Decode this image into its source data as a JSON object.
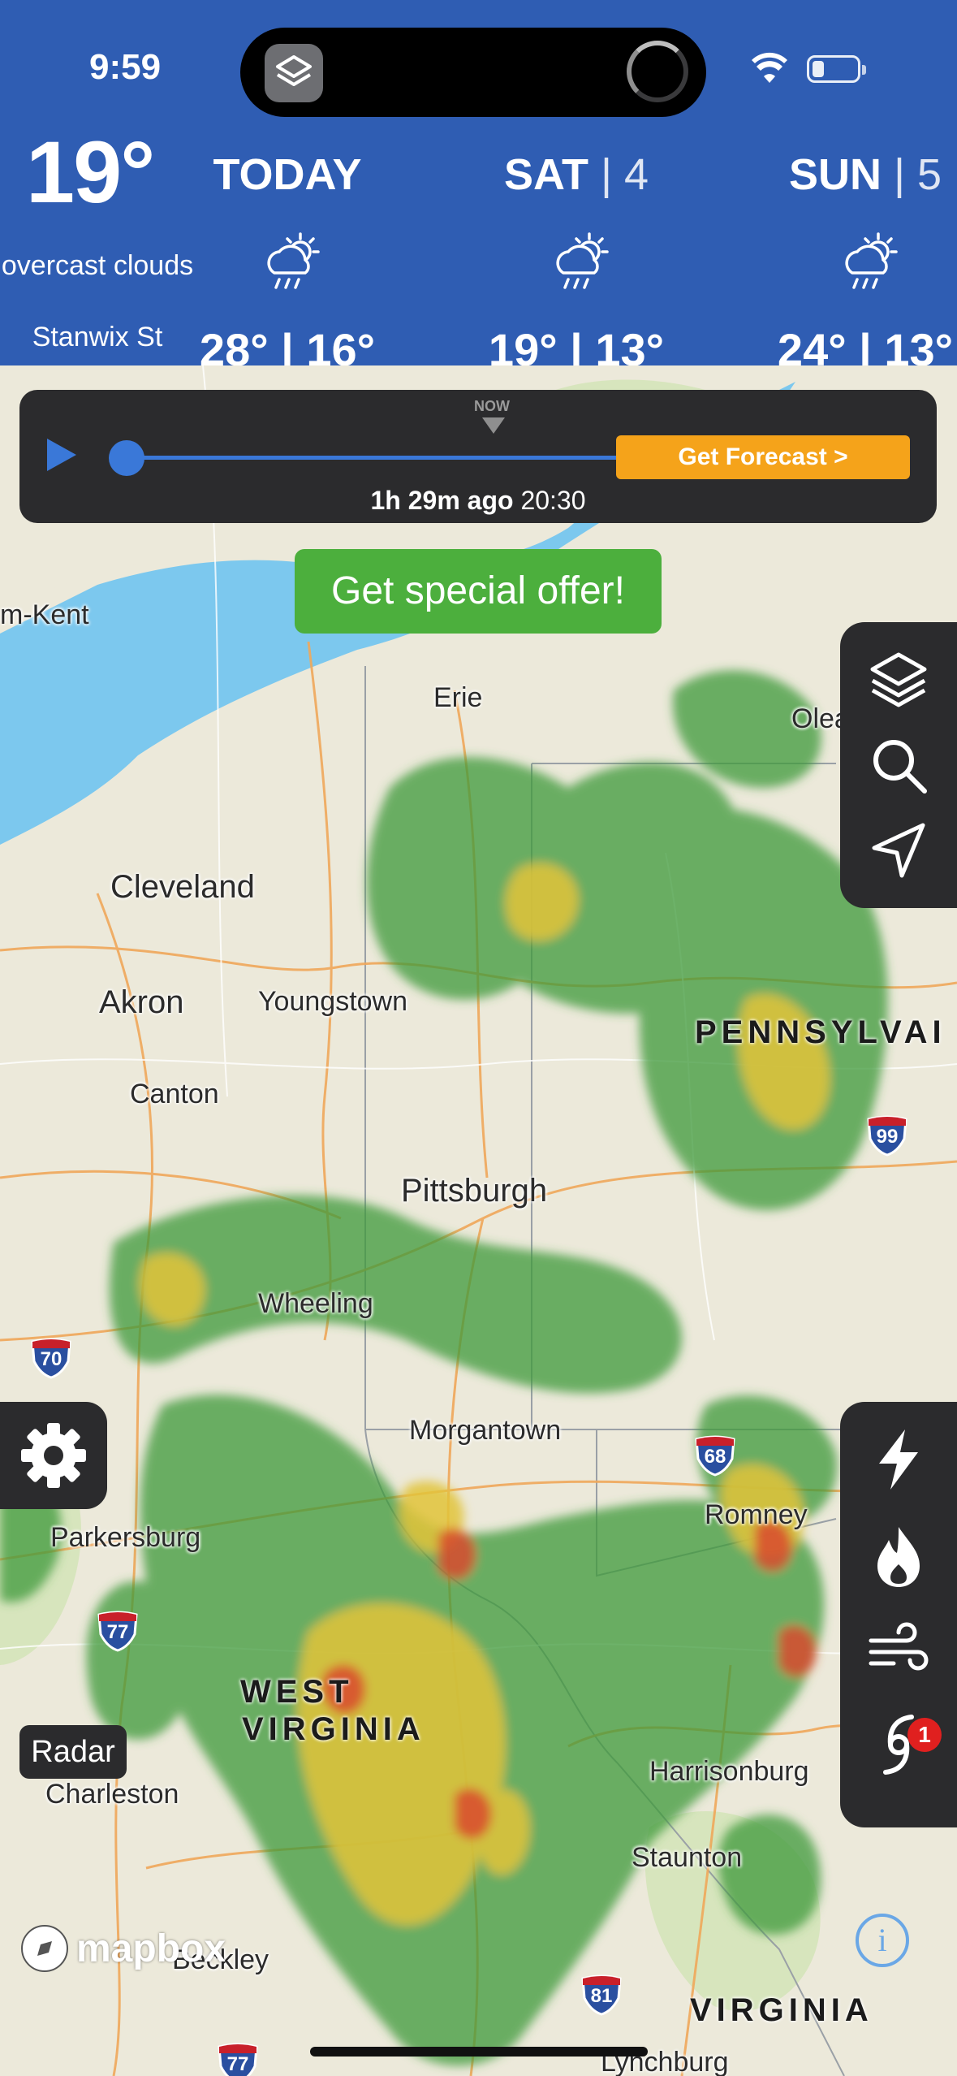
{
  "status_bar": {
    "time": "9:59"
  },
  "current": {
    "temp": "19°",
    "condition": "overcast clouds",
    "location": "Stanwix St"
  },
  "forecast": [
    {
      "label": "TODAY",
      "date": "",
      "temps": "28° | 16°",
      "icon": "rain-sun-icon"
    },
    {
      "label": "SAT",
      "date": "4",
      "temps": "19° | 13°",
      "icon": "rain-sun-icon"
    },
    {
      "label": "SUN",
      "date": "5",
      "temps": "24° | 13°",
      "icon": "rain-sun-icon"
    }
  ],
  "timeline": {
    "now_label": "NOW",
    "forecast_button": "Get Forecast  >",
    "ago": "1h 29m ago",
    "time": "20:30"
  },
  "offer": {
    "label": "Get special offer!"
  },
  "map": {
    "cities": [
      "Erie",
      "Cleveland",
      "Akron",
      "Youngstown",
      "Canton",
      "Pittsburgh",
      "Wheeling",
      "Morgantown",
      "Romney",
      "Parkersburg",
      "Charleston",
      "Harrisonburg",
      "Staunton",
      "Beckley",
      "Lynchburg",
      "m-Kent",
      "Olea"
    ],
    "states": {
      "pennsylvania": "PENNSYLVAI",
      "west_virginia_1": "WEST",
      "west_virginia_2": "VIRGINIA",
      "virginia": "VIRGINIA"
    },
    "highways": [
      "70",
      "77",
      "99",
      "68",
      "81",
      "77"
    ]
  },
  "controls": {
    "radar_label": "Radar",
    "mapbox": "mapbox",
    "info": "i",
    "badge_count": "1"
  },
  "colors": {
    "header": "#2f5db3",
    "accent": "#3a78d8",
    "forecast_button": "#f5a31a",
    "offer": "#4caf3d",
    "panel": "#2b2b2d"
  }
}
